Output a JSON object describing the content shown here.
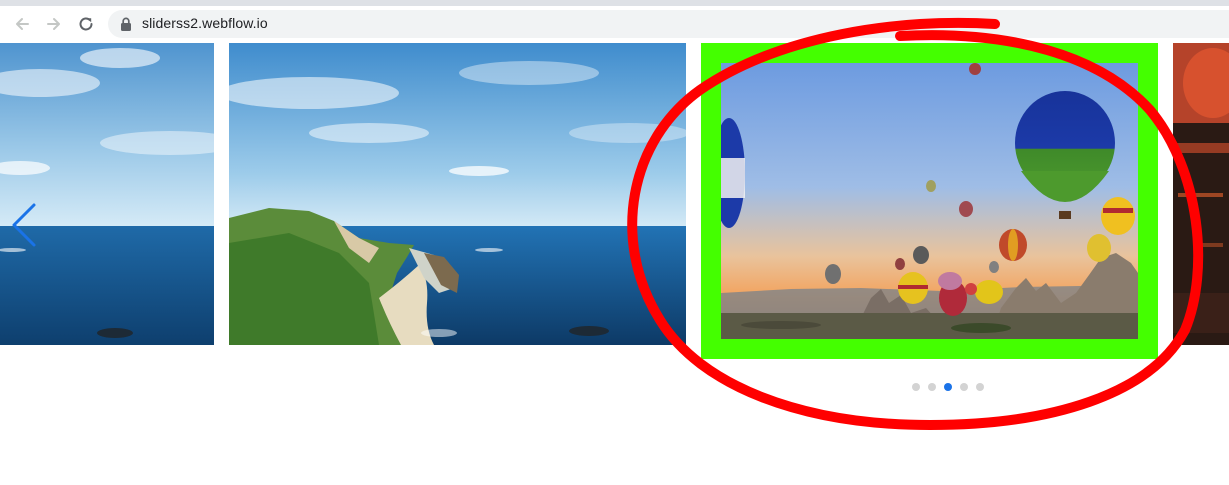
{
  "browser": {
    "url": "sliderss2.webflow.io",
    "back_icon": "arrow-left-icon",
    "forward_icon": "arrow-right-icon",
    "reload_icon": "reload-icon",
    "lock_icon": "lock-icon"
  },
  "slider": {
    "prev_icon": "chevron-left-icon",
    "slides": [
      {
        "subject": "sea-horizon-cropped"
      },
      {
        "subject": "coastal-cliff-and-sea"
      },
      {
        "subject": "hot-air-balloons-at-sunrise",
        "highlighted": true
      },
      {
        "subject": "warm-red-lights-cropped"
      }
    ],
    "dots_total": 5,
    "dots_active_index": 2
  },
  "colors": {
    "highlight_frame": "#44ff00",
    "annotation_circle": "#ff0000",
    "active_dot": "#1a73e8",
    "inactive_dot": "#d3d3d3",
    "arrow": "#1a73e8"
  }
}
